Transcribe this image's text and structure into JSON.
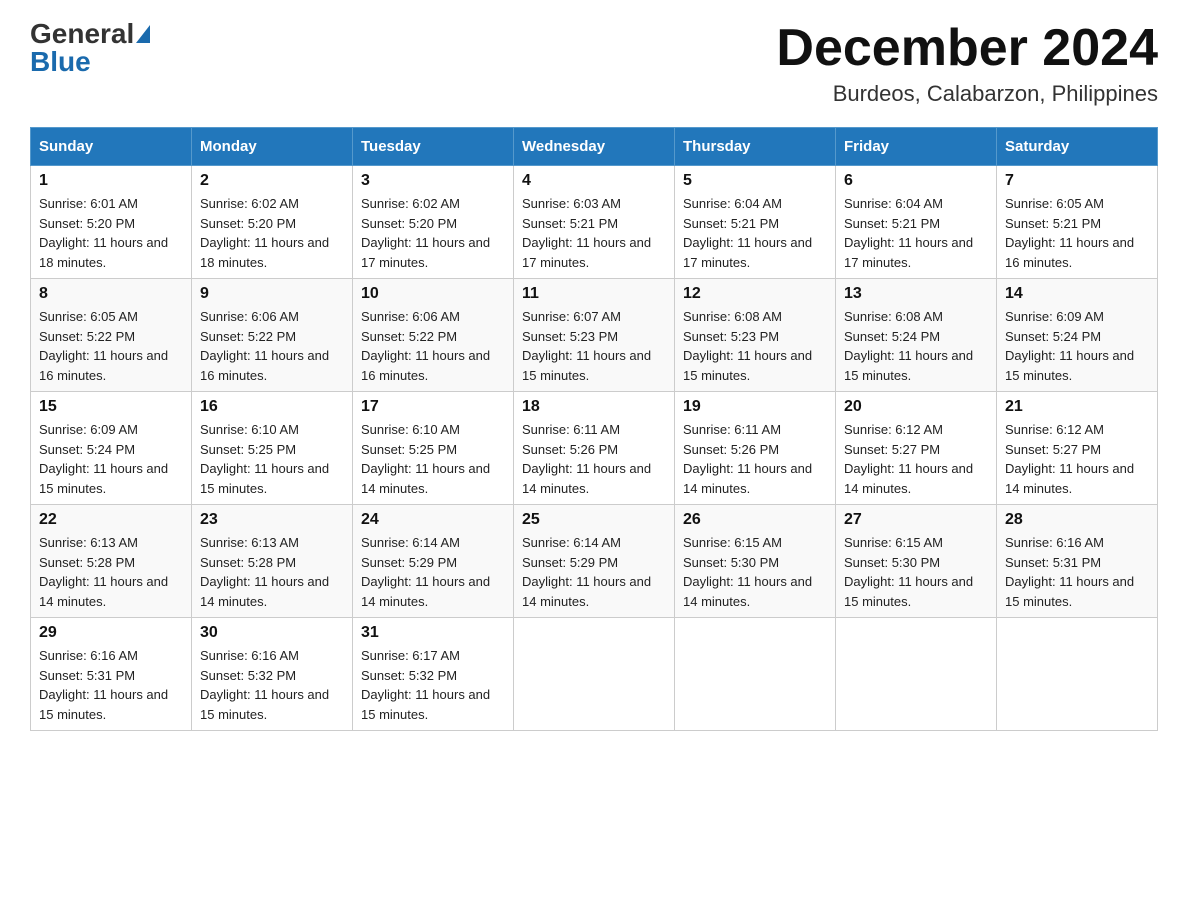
{
  "header": {
    "logo": {
      "general": "General",
      "blue": "Blue"
    },
    "title": "December 2024",
    "subtitle": "Burdeos, Calabarzon, Philippines"
  },
  "days_of_week": [
    "Sunday",
    "Monday",
    "Tuesday",
    "Wednesday",
    "Thursday",
    "Friday",
    "Saturday"
  ],
  "weeks": [
    [
      {
        "day": "1",
        "sunrise": "6:01 AM",
        "sunset": "5:20 PM",
        "daylight": "11 hours and 18 minutes."
      },
      {
        "day": "2",
        "sunrise": "6:02 AM",
        "sunset": "5:20 PM",
        "daylight": "11 hours and 18 minutes."
      },
      {
        "day": "3",
        "sunrise": "6:02 AM",
        "sunset": "5:20 PM",
        "daylight": "11 hours and 17 minutes."
      },
      {
        "day": "4",
        "sunrise": "6:03 AM",
        "sunset": "5:21 PM",
        "daylight": "11 hours and 17 minutes."
      },
      {
        "day": "5",
        "sunrise": "6:04 AM",
        "sunset": "5:21 PM",
        "daylight": "11 hours and 17 minutes."
      },
      {
        "day": "6",
        "sunrise": "6:04 AM",
        "sunset": "5:21 PM",
        "daylight": "11 hours and 17 minutes."
      },
      {
        "day": "7",
        "sunrise": "6:05 AM",
        "sunset": "5:21 PM",
        "daylight": "11 hours and 16 minutes."
      }
    ],
    [
      {
        "day": "8",
        "sunrise": "6:05 AM",
        "sunset": "5:22 PM",
        "daylight": "11 hours and 16 minutes."
      },
      {
        "day": "9",
        "sunrise": "6:06 AM",
        "sunset": "5:22 PM",
        "daylight": "11 hours and 16 minutes."
      },
      {
        "day": "10",
        "sunrise": "6:06 AM",
        "sunset": "5:22 PM",
        "daylight": "11 hours and 16 minutes."
      },
      {
        "day": "11",
        "sunrise": "6:07 AM",
        "sunset": "5:23 PM",
        "daylight": "11 hours and 15 minutes."
      },
      {
        "day": "12",
        "sunrise": "6:08 AM",
        "sunset": "5:23 PM",
        "daylight": "11 hours and 15 minutes."
      },
      {
        "day": "13",
        "sunrise": "6:08 AM",
        "sunset": "5:24 PM",
        "daylight": "11 hours and 15 minutes."
      },
      {
        "day": "14",
        "sunrise": "6:09 AM",
        "sunset": "5:24 PM",
        "daylight": "11 hours and 15 minutes."
      }
    ],
    [
      {
        "day": "15",
        "sunrise": "6:09 AM",
        "sunset": "5:24 PM",
        "daylight": "11 hours and 15 minutes."
      },
      {
        "day": "16",
        "sunrise": "6:10 AM",
        "sunset": "5:25 PM",
        "daylight": "11 hours and 15 minutes."
      },
      {
        "day": "17",
        "sunrise": "6:10 AM",
        "sunset": "5:25 PM",
        "daylight": "11 hours and 14 minutes."
      },
      {
        "day": "18",
        "sunrise": "6:11 AM",
        "sunset": "5:26 PM",
        "daylight": "11 hours and 14 minutes."
      },
      {
        "day": "19",
        "sunrise": "6:11 AM",
        "sunset": "5:26 PM",
        "daylight": "11 hours and 14 minutes."
      },
      {
        "day": "20",
        "sunrise": "6:12 AM",
        "sunset": "5:27 PM",
        "daylight": "11 hours and 14 minutes."
      },
      {
        "day": "21",
        "sunrise": "6:12 AM",
        "sunset": "5:27 PM",
        "daylight": "11 hours and 14 minutes."
      }
    ],
    [
      {
        "day": "22",
        "sunrise": "6:13 AM",
        "sunset": "5:28 PM",
        "daylight": "11 hours and 14 minutes."
      },
      {
        "day": "23",
        "sunrise": "6:13 AM",
        "sunset": "5:28 PM",
        "daylight": "11 hours and 14 minutes."
      },
      {
        "day": "24",
        "sunrise": "6:14 AM",
        "sunset": "5:29 PM",
        "daylight": "11 hours and 14 minutes."
      },
      {
        "day": "25",
        "sunrise": "6:14 AM",
        "sunset": "5:29 PM",
        "daylight": "11 hours and 14 minutes."
      },
      {
        "day": "26",
        "sunrise": "6:15 AM",
        "sunset": "5:30 PM",
        "daylight": "11 hours and 14 minutes."
      },
      {
        "day": "27",
        "sunrise": "6:15 AM",
        "sunset": "5:30 PM",
        "daylight": "11 hours and 15 minutes."
      },
      {
        "day": "28",
        "sunrise": "6:16 AM",
        "sunset": "5:31 PM",
        "daylight": "11 hours and 15 minutes."
      }
    ],
    [
      {
        "day": "29",
        "sunrise": "6:16 AM",
        "sunset": "5:31 PM",
        "daylight": "11 hours and 15 minutes."
      },
      {
        "day": "30",
        "sunrise": "6:16 AM",
        "sunset": "5:32 PM",
        "daylight": "11 hours and 15 minutes."
      },
      {
        "day": "31",
        "sunrise": "6:17 AM",
        "sunset": "5:32 PM",
        "daylight": "11 hours and 15 minutes."
      },
      null,
      null,
      null,
      null
    ]
  ],
  "labels": {
    "sunrise_prefix": "Sunrise: ",
    "sunset_prefix": "Sunset: ",
    "daylight_prefix": "Daylight: "
  }
}
